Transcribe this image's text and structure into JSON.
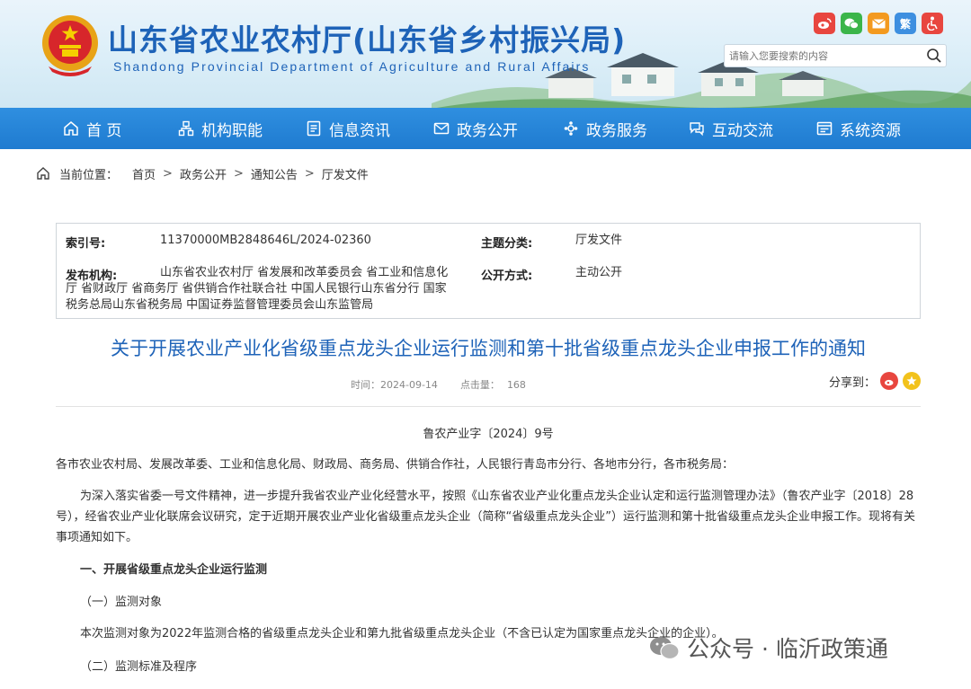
{
  "header": {
    "title": "山东省农业农村厅(山东省乡村振兴局)",
    "subtitle": "Shandong Provincial Department of Agriculture and Rural Affairs",
    "search_placeholder": "请输入您要搜索的内容",
    "traditional_label": "繁",
    "colors": {
      "brand": "#1e63b8",
      "nav": "#1f7bd0"
    }
  },
  "nav": {
    "items": [
      {
        "label": "首 页",
        "icon": "home-icon"
      },
      {
        "label": "机构职能",
        "icon": "org-icon"
      },
      {
        "label": "信息资讯",
        "icon": "document-icon"
      },
      {
        "label": "政务公开",
        "icon": "envelope-icon"
      },
      {
        "label": "政务服务",
        "icon": "service-icon"
      },
      {
        "label": "互动交流",
        "icon": "interact-icon"
      },
      {
        "label": "系统资源",
        "icon": "system-icon"
      }
    ]
  },
  "breadcrumb": {
    "prefix": "当前位置：",
    "items": [
      "首页",
      "政务公开",
      "通知公告",
      "厅发文件"
    ],
    "sep": ">"
  },
  "info": {
    "index_label": "索引号:",
    "index_value": "11370000MB2848646L/2024-02360",
    "topic_label": "主题分类:",
    "topic_value": "厅发文件",
    "publisher_label": "发布机构:",
    "publisher_value": "山东省农业农村厅 省发展和改革委员会 省工业和信息化厅 省财政厅 省商务厅 省供销合作社联合社 中国人民银行山东省分行 国家税务总局山东省税务局 中国证券监督管理委员会山东监管局",
    "open_label": "公开方式:",
    "open_value": "主动公开"
  },
  "article": {
    "title": "关于开展农业产业化省级重点龙头企业运行监测和第十批省级重点龙头企业申报工作的通知",
    "time_label": "时间：",
    "time_value": "2024-09-14",
    "clicks_label": "点击量：",
    "clicks_value": "168",
    "share_label": "分享到：",
    "doc_number": "鲁农产业字〔2024〕9号",
    "recipients": "各市农业农村局、发展改革委、工业和信息化局、财政局、商务局、供销合作社，人民银行青岛市分行、各地市分行，各市税务局：",
    "para1": "为深入落实省委一号文件精神，进一步提升我省农业产业化经营水平，按照《山东省农业产业化重点龙头企业认定和运行监测管理办法》（鲁农产业字〔2018〕28号），经省农业产业化联席会议研究，定于近期开展农业产业化省级重点龙头企业（简称“省级重点龙头企业”）运行监测和第十批省级重点龙头企业申报工作。现将有关事项通知如下。",
    "section1": "一、开展省级重点龙头企业运行监测",
    "sub1": "（一）监测对象",
    "para2": "本次监测对象为2022年监测合格的省级重点龙头企业和第九批省级重点龙头企业（不含已认定为国家重点龙头企业的企业）。",
    "sub2": "（二）监测标准及程序"
  },
  "watermark": {
    "text": "公众号 · 临沂政策通"
  }
}
